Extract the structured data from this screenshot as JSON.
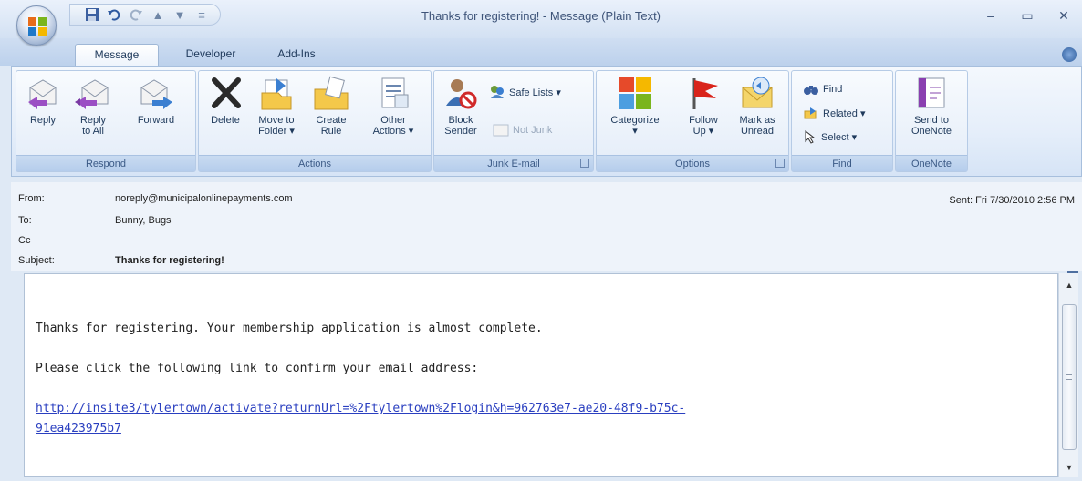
{
  "window": {
    "title": "Thanks for registering! - Message (Plain Text)"
  },
  "icons": {
    "office": "office-logo-icon",
    "save": "save-icon",
    "undo": "undo-icon",
    "redo": "redo-icon",
    "up": "up-arrow-icon",
    "down": "down-arrow-icon",
    "customize": "customize-icon"
  },
  "tabs": [
    {
      "label": "Message",
      "active": true
    },
    {
      "label": "Developer",
      "active": false
    },
    {
      "label": "Add-Ins",
      "active": false
    }
  ],
  "ribbon": {
    "respond": {
      "label": "Respond",
      "reply": "Reply",
      "reply_all_1": "Reply",
      "reply_all_2": "to All",
      "forward": "Forward"
    },
    "actions": {
      "label": "Actions",
      "delete": "Delete",
      "move_1": "Move to",
      "move_2": "Folder ▾",
      "rule_1": "Create",
      "rule_2": "Rule",
      "other_1": "Other",
      "other_2": "Actions ▾"
    },
    "junk": {
      "label": "Junk E-mail",
      "block_1": "Block",
      "block_2": "Sender",
      "safe_lists": "Safe Lists ▾",
      "not_junk": "Not Junk"
    },
    "options": {
      "label": "Options",
      "categorize": "Categorize",
      "categorize_2": "▾",
      "follow_1": "Follow",
      "follow_2": "Up ▾",
      "mark_1": "Mark as",
      "mark_2": "Unread"
    },
    "find": {
      "label": "Find",
      "find": "Find",
      "related": "Related ▾",
      "select": "Select ▾"
    },
    "onenote": {
      "label": "OneNote",
      "send_1": "Send to",
      "send_2": "OneNote"
    }
  },
  "header": {
    "from_label": "From:",
    "from_value": "noreply@municipalonlinepayments.com",
    "to_label": "To:",
    "to_value": "Bunny, Bugs",
    "cc_label": "Cc",
    "subject_label": "Subject:",
    "subject_value": "Thanks for registering!",
    "sent_label": "Sent:",
    "sent_value": "Fri 7/30/2010 2:56 PM"
  },
  "body": {
    "line1": "Thanks for registering. Your membership application is almost complete.",
    "line2": "Please click the following link to confirm your email address:",
    "link_line1": "http://insite3/tylertown/activate?returnUrl=%2Ftylertown%2Flogin&h=962763e7-ae20-48f9-b75c-",
    "link_line2": "91ea423975b7"
  },
  "colors": {
    "accent": "#1e395b",
    "link": "#2a3fc0",
    "ribbon_bg": "#dfe9f5"
  }
}
